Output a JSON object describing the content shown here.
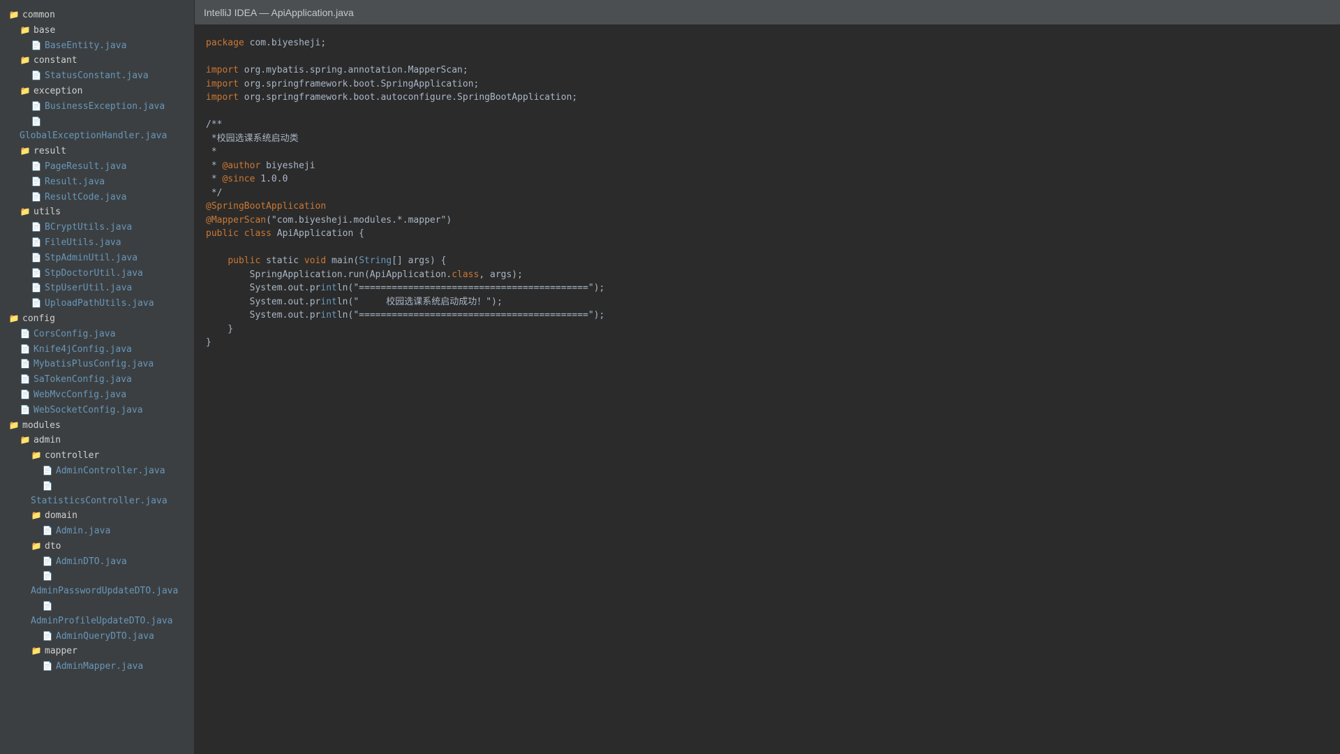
{
  "window_title": "IntelliJ IDEA — ApiApplication.java",
  "tree": [
    {
      "type": "folder",
      "depth": 0,
      "label": "common"
    },
    {
      "type": "folder",
      "depth": 1,
      "label": "base"
    },
    {
      "type": "file",
      "depth": 2,
      "label": "BaseEntity.java"
    },
    {
      "type": "folder",
      "depth": 1,
      "label": "constant"
    },
    {
      "type": "file",
      "depth": 2,
      "label": "StatusConstant.java"
    },
    {
      "type": "folder",
      "depth": 1,
      "label": "exception"
    },
    {
      "type": "file",
      "depth": 2,
      "label": "BusinessException.java"
    },
    {
      "type": "file",
      "depth": 2,
      "label": "GlobalExceptionHandler.java",
      "wrap": true
    },
    {
      "type": "folder",
      "depth": 1,
      "label": "result"
    },
    {
      "type": "file",
      "depth": 2,
      "label": "PageResult.java"
    },
    {
      "type": "file",
      "depth": 2,
      "label": "Result.java"
    },
    {
      "type": "file",
      "depth": 2,
      "label": "ResultCode.java"
    },
    {
      "type": "folder",
      "depth": 1,
      "label": "utils"
    },
    {
      "type": "file",
      "depth": 2,
      "label": "BCryptUtils.java"
    },
    {
      "type": "file",
      "depth": 2,
      "label": "FileUtils.java"
    },
    {
      "type": "file",
      "depth": 2,
      "label": "StpAdminUtil.java"
    },
    {
      "type": "file",
      "depth": 2,
      "label": "StpDoctorUtil.java"
    },
    {
      "type": "file",
      "depth": 2,
      "label": "StpUserUtil.java"
    },
    {
      "type": "file",
      "depth": 2,
      "label": "UploadPathUtils.java"
    },
    {
      "type": "folder",
      "depth": 0,
      "label": "config"
    },
    {
      "type": "file",
      "depth": 1,
      "label": "CorsConfig.java"
    },
    {
      "type": "file",
      "depth": 1,
      "label": "Knife4jConfig.java"
    },
    {
      "type": "file",
      "depth": 1,
      "label": "MybatisPlusConfig.java"
    },
    {
      "type": "file",
      "depth": 1,
      "label": "SaTokenConfig.java"
    },
    {
      "type": "file",
      "depth": 1,
      "label": "WebMvcConfig.java"
    },
    {
      "type": "file",
      "depth": 1,
      "label": "WebSocketConfig.java"
    },
    {
      "type": "folder",
      "depth": 0,
      "label": "modules"
    },
    {
      "type": "folder",
      "depth": 1,
      "label": "admin"
    },
    {
      "type": "folder",
      "depth": 2,
      "label": "controller"
    },
    {
      "type": "file",
      "depth": 3,
      "label": "AdminController.java"
    },
    {
      "type": "file",
      "depth": 3,
      "label": "StatisticsController.java",
      "wrap": true
    },
    {
      "type": "folder",
      "depth": 2,
      "label": "domain"
    },
    {
      "type": "file",
      "depth": 3,
      "label": "Admin.java"
    },
    {
      "type": "folder",
      "depth": 2,
      "label": "dto"
    },
    {
      "type": "file",
      "depth": 3,
      "label": "AdminDTO.java"
    },
    {
      "type": "file",
      "depth": 3,
      "label": "AdminPasswordUpdateDTO.java",
      "wrap": true
    },
    {
      "type": "file",
      "depth": 3,
      "label": "AdminProfileUpdateDTO.java",
      "wrap": true
    },
    {
      "type": "file",
      "depth": 3,
      "label": "AdminQueryDTO.java"
    },
    {
      "type": "folder",
      "depth": 2,
      "label": "mapper"
    },
    {
      "type": "file",
      "depth": 3,
      "label": "AdminMapper.java"
    }
  ],
  "code": [
    [
      [
        "kw",
        "package"
      ],
      [
        "t",
        " com.biyesheji;"
      ]
    ],
    [],
    [
      [
        "kw",
        "import"
      ],
      [
        "t",
        " org.mybatis.spring.annotation.MapperScan;"
      ]
    ],
    [
      [
        "kw",
        "import"
      ],
      [
        "t",
        " org.springframework.boot.SpringApplication;"
      ]
    ],
    [
      [
        "kw",
        "import"
      ],
      [
        "t",
        " org.springframework.boot.autoconfigure.SpringBootApplication;"
      ]
    ],
    [],
    [
      [
        "t",
        "/**"
      ]
    ],
    [
      [
        "t",
        " *校园选课系统启动类"
      ]
    ],
    [
      [
        "t",
        " *"
      ]
    ],
    [
      [
        "t",
        " * "
      ],
      [
        "tag",
        "@author"
      ],
      [
        "t",
        " biyesheji"
      ]
    ],
    [
      [
        "t",
        " * "
      ],
      [
        "tag",
        "@since"
      ],
      [
        "t",
        " 1.0.0"
      ]
    ],
    [
      [
        "t",
        " */"
      ]
    ],
    [
      [
        "kw",
        "@SpringBootApplication"
      ]
    ],
    [
      [
        "kw",
        "@MapperScan"
      ],
      [
        "t",
        "(\"com.biyesheji.modules.*.mapper\")"
      ]
    ],
    [
      [
        "kw",
        "public class"
      ],
      [
        "t",
        " ApiApplication {"
      ]
    ],
    [],
    [
      [
        "t",
        "    "
      ],
      [
        "kw",
        "public"
      ],
      [
        "t",
        " static "
      ],
      [
        "kw",
        "void"
      ],
      [
        "t",
        " main("
      ],
      [
        "cls",
        "String"
      ],
      [
        "t",
        "[] args) {"
      ]
    ],
    [
      [
        "t",
        "        SpringApplication.run(ApiApplication."
      ],
      [
        "kw",
        "class"
      ],
      [
        "t",
        ", args);"
      ]
    ],
    [
      [
        "t",
        "        System.out.pr"
      ],
      [
        "cls",
        "int"
      ],
      [
        "t",
        "ln(\"==========================================\");"
      ]
    ],
    [
      [
        "t",
        "        System.out.pr"
      ],
      [
        "cls",
        "int"
      ],
      [
        "t",
        "ln(\"     校园选课系统启动成功！\");"
      ]
    ],
    [
      [
        "t",
        "        System.out.pr"
      ],
      [
        "cls",
        "int"
      ],
      [
        "t",
        "ln(\"==========================================\");"
      ]
    ],
    [
      [
        "t",
        "    }"
      ]
    ],
    [
      [
        "t",
        "}"
      ]
    ]
  ]
}
